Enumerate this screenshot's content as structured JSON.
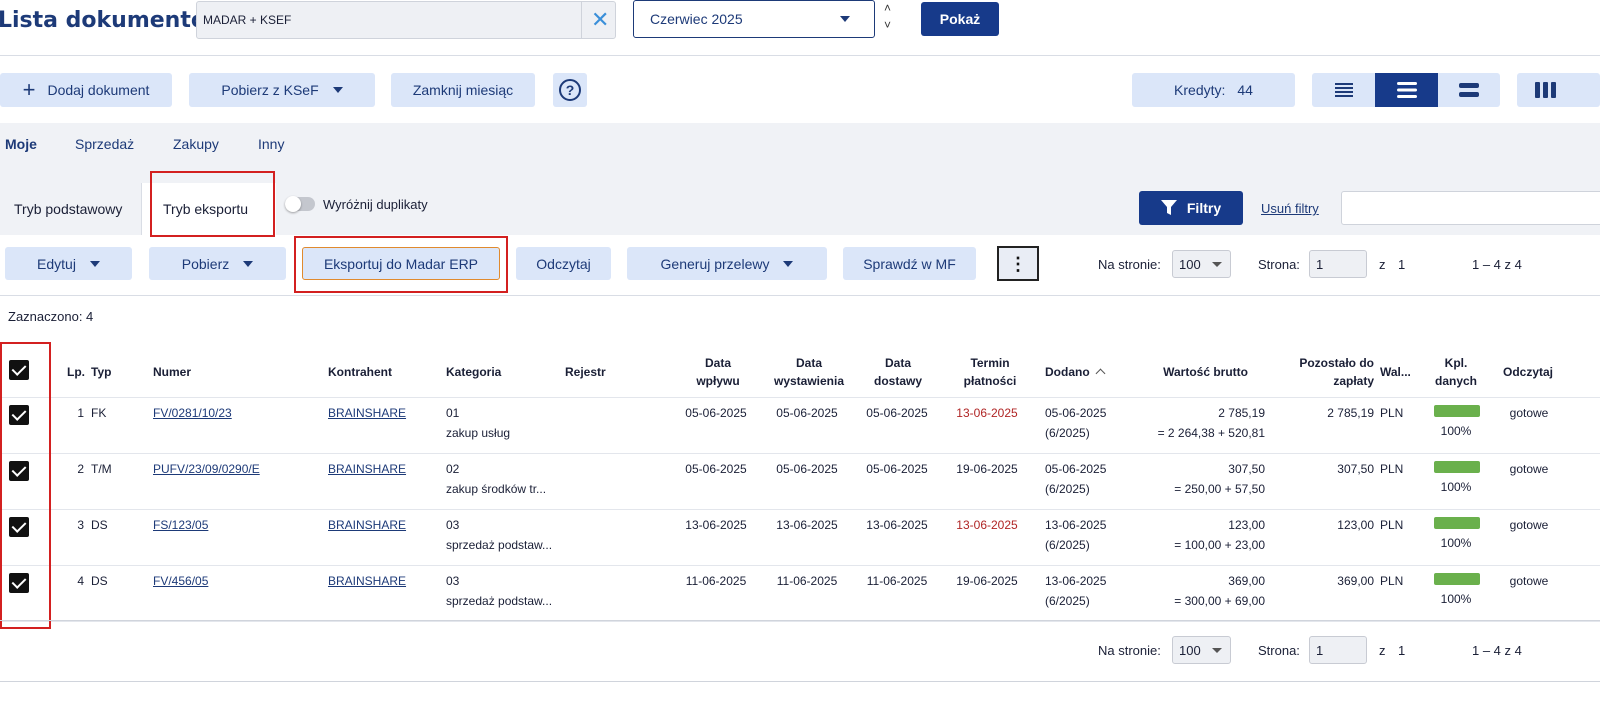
{
  "header": {
    "title": "Lista dokumentów",
    "search_value": "MADAR + KSEF",
    "period": "Czerwiec 2025",
    "show_label": "Pokaż"
  },
  "toolbar": {
    "add_label": "Dodaj dokument",
    "ksef_label": "Pobierz z KSeF",
    "close_month_label": "Zamknij miesiąc",
    "credits_label": "Kredyty:",
    "credits_value": "44"
  },
  "doc_tabs": [
    "Moje",
    "Sprzedaż",
    "Zakupy",
    "Inny"
  ],
  "mode_tabs": {
    "basic": "Tryb podstawowy",
    "export": "Tryb eksportu",
    "dup_toggle": "Wyróżnij duplikaty",
    "filters": "Filtry",
    "clear_filters": "Usuń filtry"
  },
  "actions": {
    "edit": "Edytuj",
    "download": "Pobierz",
    "export": "Eksportuj do Madar ERP",
    "read": "Odczytaj",
    "transfers": "Generuj przelewy",
    "check_mf": "Sprawdź w MF"
  },
  "pager": {
    "per_page_label": "Na stronie:",
    "per_page": "100",
    "page_label": "Strona:",
    "page": "1",
    "of_label": "z",
    "total_pages": "1",
    "range": "1 – 4 z 4"
  },
  "selected_label": "Zaznaczono: 4",
  "columns": {
    "lp": "Lp.",
    "typ": "Typ",
    "numer": "Numer",
    "kontrahent": "Kontrahent",
    "kategoria": "Kategoria",
    "rejestr": "Rejestr",
    "data_wplywu_1": "Data",
    "data_wplywu_2": "wpływu",
    "data_wyst_1": "Data",
    "data_wyst_2": "wystawienia",
    "data_dost_1": "Data",
    "data_dost_2": "dostawy",
    "termin_1": "Termin",
    "termin_2": "płatności",
    "dodano": "Dodano",
    "wartosc": "Wartość brutto",
    "pozostalo_1": "Pozostało do",
    "pozostalo_2": "zapłaty",
    "waluta": "Wal...",
    "kpl_1": "Kpl.",
    "kpl_2": "danych",
    "odczytaj": "Odczytaj"
  },
  "rows": [
    {
      "lp": "1",
      "typ": "FK",
      "numer": "FV/0281/10/23",
      "kontrahent": "BRAINSHARE",
      "kat_code": "01",
      "kat_name": "zakup usług",
      "wplyw": "05-06-2025",
      "wyst": "05-06-2025",
      "dost": "05-06-2025",
      "termin": "13-06-2025",
      "termin_overdue": true,
      "dodano": "05-06-2025",
      "dodano_sub": "(6/2025)",
      "brutto": "2 785,19",
      "brutto_sub": "= 2 264,38 + 520,81",
      "pozostalo": "2 785,19",
      "waluta": "PLN",
      "kpl": "100%",
      "odczytaj": "gotowe"
    },
    {
      "lp": "2",
      "typ": "T/M",
      "numer": "PUFV/23/09/0290/E",
      "kontrahent": "BRAINSHARE",
      "kat_code": "02",
      "kat_name": "zakup środków tr...",
      "wplyw": "05-06-2025",
      "wyst": "05-06-2025",
      "dost": "05-06-2025",
      "termin": "19-06-2025",
      "termin_overdue": false,
      "dodano": "05-06-2025",
      "dodano_sub": "(6/2025)",
      "brutto": "307,50",
      "brutto_sub": "= 250,00 + 57,50",
      "pozostalo": "307,50",
      "waluta": "PLN",
      "kpl": "100%",
      "odczytaj": "gotowe"
    },
    {
      "lp": "3",
      "typ": "DS",
      "numer": "FS/123/05",
      "kontrahent": "BRAINSHARE",
      "kat_code": "03",
      "kat_name": "sprzedaż podstaw...",
      "wplyw": "13-06-2025",
      "wyst": "13-06-2025",
      "dost": "13-06-2025",
      "termin": "13-06-2025",
      "termin_overdue": true,
      "dodano": "13-06-2025",
      "dodano_sub": "(6/2025)",
      "brutto": "123,00",
      "brutto_sub": "= 100,00 + 23,00",
      "pozostalo": "123,00",
      "waluta": "PLN",
      "kpl": "100%",
      "odczytaj": "gotowe"
    },
    {
      "lp": "4",
      "typ": "DS",
      "numer": "FV/456/05",
      "kontrahent": "BRAINSHARE",
      "kat_code": "03",
      "kat_name": "sprzedaż podstaw...",
      "wplyw": "11-06-2025",
      "wyst": "11-06-2025",
      "dost": "11-06-2025",
      "termin": "19-06-2025",
      "termin_overdue": false,
      "dodano": "13-06-2025",
      "dodano_sub": "(6/2025)",
      "brutto": "369,00",
      "brutto_sub": "= 300,00 + 69,00",
      "pozostalo": "369,00",
      "waluta": "PLN",
      "kpl": "100%",
      "odczytaj": "gotowe"
    }
  ],
  "colors": {
    "primary": "#173a8a",
    "light_button": "#dbe6f9",
    "overdue": "#b02525",
    "progress": "#6ab04c",
    "highlight": "#d32020"
  }
}
